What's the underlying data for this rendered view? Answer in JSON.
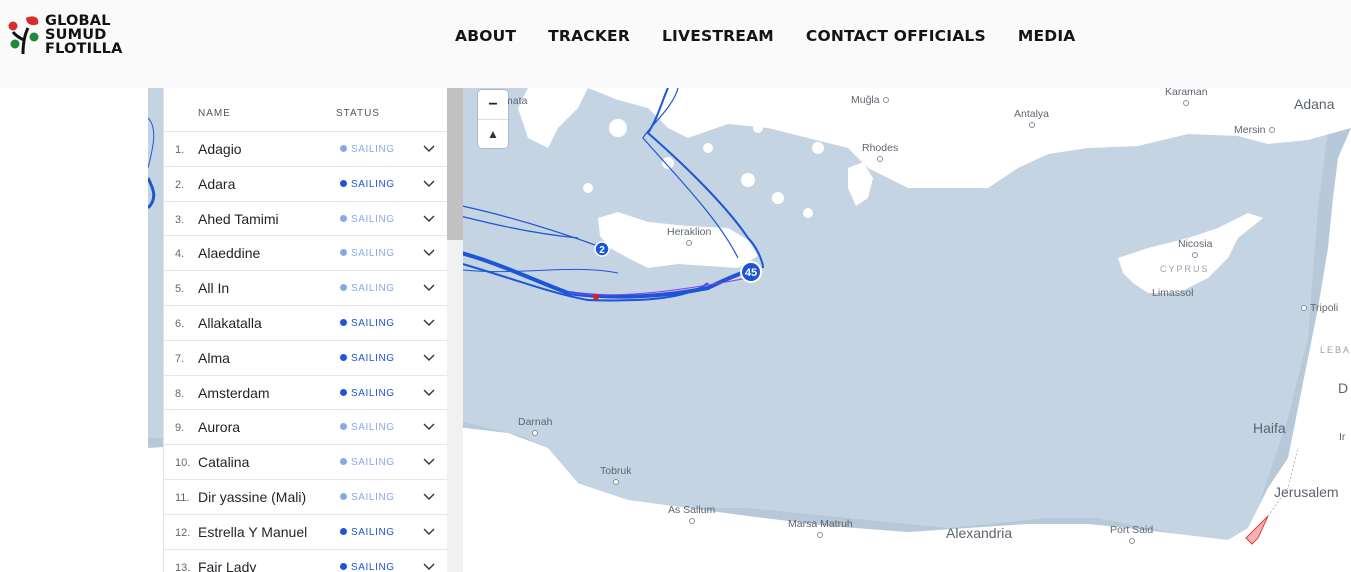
{
  "brand": {
    "line1": "GLOBAL",
    "line2": "SUMUD",
    "line3": "FLOTILLA",
    "colors": {
      "red": "#d82d2d",
      "green": "#1f8a3a",
      "black": "#111111"
    }
  },
  "nav": {
    "items": [
      "ABOUT",
      "TRACKER",
      "LIVESTREAM",
      "CONTACT OFFICIALS",
      "MEDIA"
    ]
  },
  "map_controls": {
    "zoom_out": "−",
    "compass": "▲"
  },
  "list": {
    "col_name": "NAME",
    "col_status": "STATUS",
    "vessels": [
      {
        "num": "1.",
        "name": "Adagio",
        "status": "SAILING",
        "tone": "light"
      },
      {
        "num": "2.",
        "name": "Adara",
        "status": "SAILING",
        "tone": "dark"
      },
      {
        "num": "3.",
        "name": "Ahed Tamimi",
        "status": "SAILING",
        "tone": "light"
      },
      {
        "num": "4.",
        "name": "Alaeddine",
        "status": "SAILING",
        "tone": "light"
      },
      {
        "num": "5.",
        "name": "All In",
        "status": "SAILING",
        "tone": "light"
      },
      {
        "num": "6.",
        "name": "Allakatalla",
        "status": "SAILING",
        "tone": "dark"
      },
      {
        "num": "7.",
        "name": "Alma",
        "status": "SAILING",
        "tone": "dark"
      },
      {
        "num": "8.",
        "name": "Amsterdam",
        "status": "SAILING",
        "tone": "dark"
      },
      {
        "num": "9.",
        "name": "Aurora",
        "status": "SAILING",
        "tone": "light"
      },
      {
        "num": "10.",
        "name": "Catalina",
        "status": "SAILING",
        "tone": "light"
      },
      {
        "num": "11.",
        "name": "Dir yassine (Mali)",
        "status": "SAILING",
        "tone": "light"
      },
      {
        "num": "12.",
        "name": "Estrella Y Manuel",
        "status": "SAILING",
        "tone": "dark"
      },
      {
        "num": "13.",
        "name": "Fair Lady",
        "status": "SAILING",
        "tone": "dark"
      }
    ]
  },
  "map": {
    "labels": {
      "mugla": "Muğla",
      "karaman": "Karaman",
      "adana": "Adana",
      "antalya": "Antalya",
      "mersin": "Mersin",
      "rhodes": "Rhodes",
      "heraklion": "Heraklion",
      "nicosia": "Nicosia",
      "cyprus": "CYPRUS",
      "limassol": "Limassol",
      "tripoli": "Tripoli",
      "leba": "LEBA",
      "haifa": "Haifa",
      "jerusalem": "Jerusalem",
      "darnah": "Darnah",
      "tobruk": "Tobruk",
      "as_sallum": "As Sallum",
      "marsa_matruh": "Marsa Matruh",
      "alexandria": "Alexandria",
      "port_said": "Port Said",
      "amata": "mata",
      "d_edge": "D",
      "ir_edge": "Ir"
    },
    "clusters": {
      "small": "2",
      "large": "45"
    },
    "colors": {
      "sea": "#c5d4e3",
      "land": "#ffffff",
      "track": "#1c55d6",
      "gaza": "#f6b0b0"
    }
  }
}
